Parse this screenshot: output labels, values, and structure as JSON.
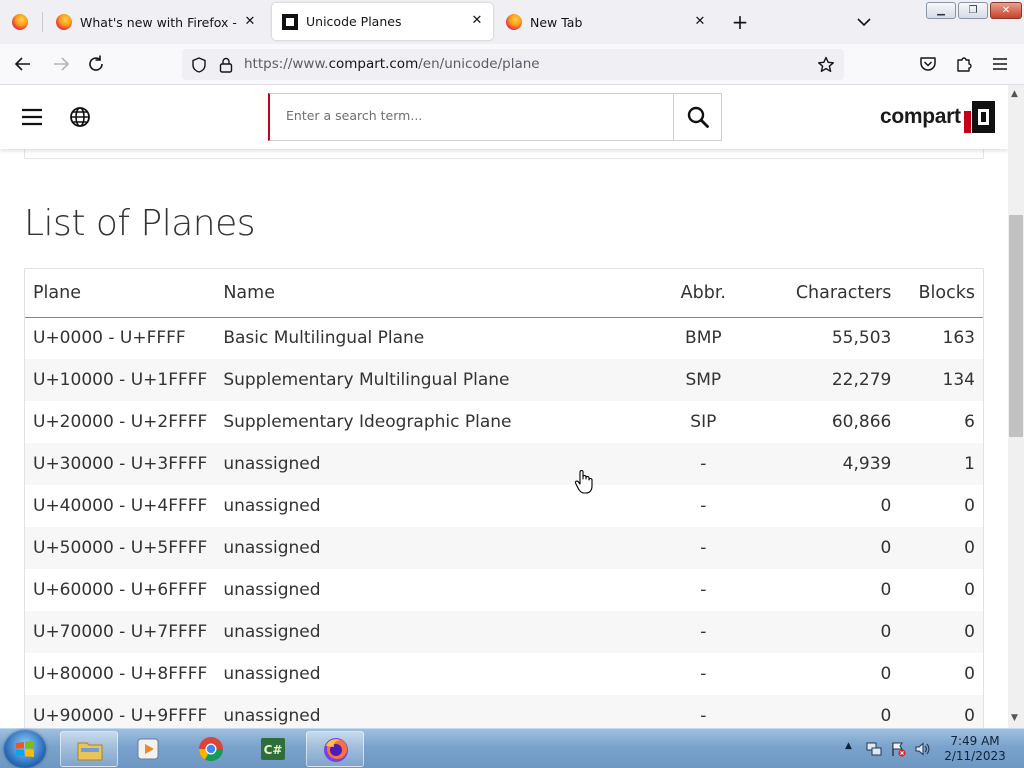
{
  "browser": {
    "tabs": [
      {
        "title": "What's new with Firefox - More",
        "active": false
      },
      {
        "title": "Unicode Planes",
        "active": true
      },
      {
        "title": "New Tab",
        "active": false
      }
    ],
    "new_tab_symbol": "+",
    "url": {
      "prefix": "https://www.",
      "domain": "compart.com",
      "path": "/en/unicode/plane"
    }
  },
  "site": {
    "search_placeholder": "Enter a search term...",
    "logo_text": "compart"
  },
  "page": {
    "title": "List of Planes",
    "table": {
      "headers": [
        "Plane",
        "Name",
        "Abbr.",
        "Characters",
        "Blocks"
      ],
      "rows": [
        {
          "plane": "U+0000 - U+FFFF",
          "name": "Basic Multilingual Plane",
          "abbr": "BMP",
          "chars": "55,503",
          "blocks": "163"
        },
        {
          "plane": "U+10000 - U+1FFFF",
          "name": "Supplementary Multilingual Plane",
          "abbr": "SMP",
          "chars": "22,279",
          "blocks": "134"
        },
        {
          "plane": "U+20000 - U+2FFFF",
          "name": "Supplementary Ideographic Plane",
          "abbr": "SIP",
          "chars": "60,866",
          "blocks": "6"
        },
        {
          "plane": "U+30000 - U+3FFFF",
          "name": "unassigned",
          "abbr": "-",
          "chars": "4,939",
          "blocks": "1"
        },
        {
          "plane": "U+40000 - U+4FFFF",
          "name": "unassigned",
          "abbr": "-",
          "chars": "0",
          "blocks": "0"
        },
        {
          "plane": "U+50000 - U+5FFFF",
          "name": "unassigned",
          "abbr": "-",
          "chars": "0",
          "blocks": "0"
        },
        {
          "plane": "U+60000 - U+6FFFF",
          "name": "unassigned",
          "abbr": "-",
          "chars": "0",
          "blocks": "0"
        },
        {
          "plane": "U+70000 - U+7FFFF",
          "name": "unassigned",
          "abbr": "-",
          "chars": "0",
          "blocks": "0"
        },
        {
          "plane": "U+80000 - U+8FFFF",
          "name": "unassigned",
          "abbr": "-",
          "chars": "0",
          "blocks": "0"
        },
        {
          "plane": "U+90000 - U+9FFFF",
          "name": "unassigned",
          "abbr": "-",
          "chars": "0",
          "blocks": "0"
        }
      ]
    }
  },
  "taskbar": {
    "time": "7:49 AM",
    "date": "2/11/2023",
    "pinned_apps": [
      "file-explorer",
      "media-player",
      "chrome",
      "csharp-ide",
      "firefox"
    ]
  },
  "colors": {
    "accent_red": "#c4001a",
    "table_header_rule": "#45a0b5"
  }
}
